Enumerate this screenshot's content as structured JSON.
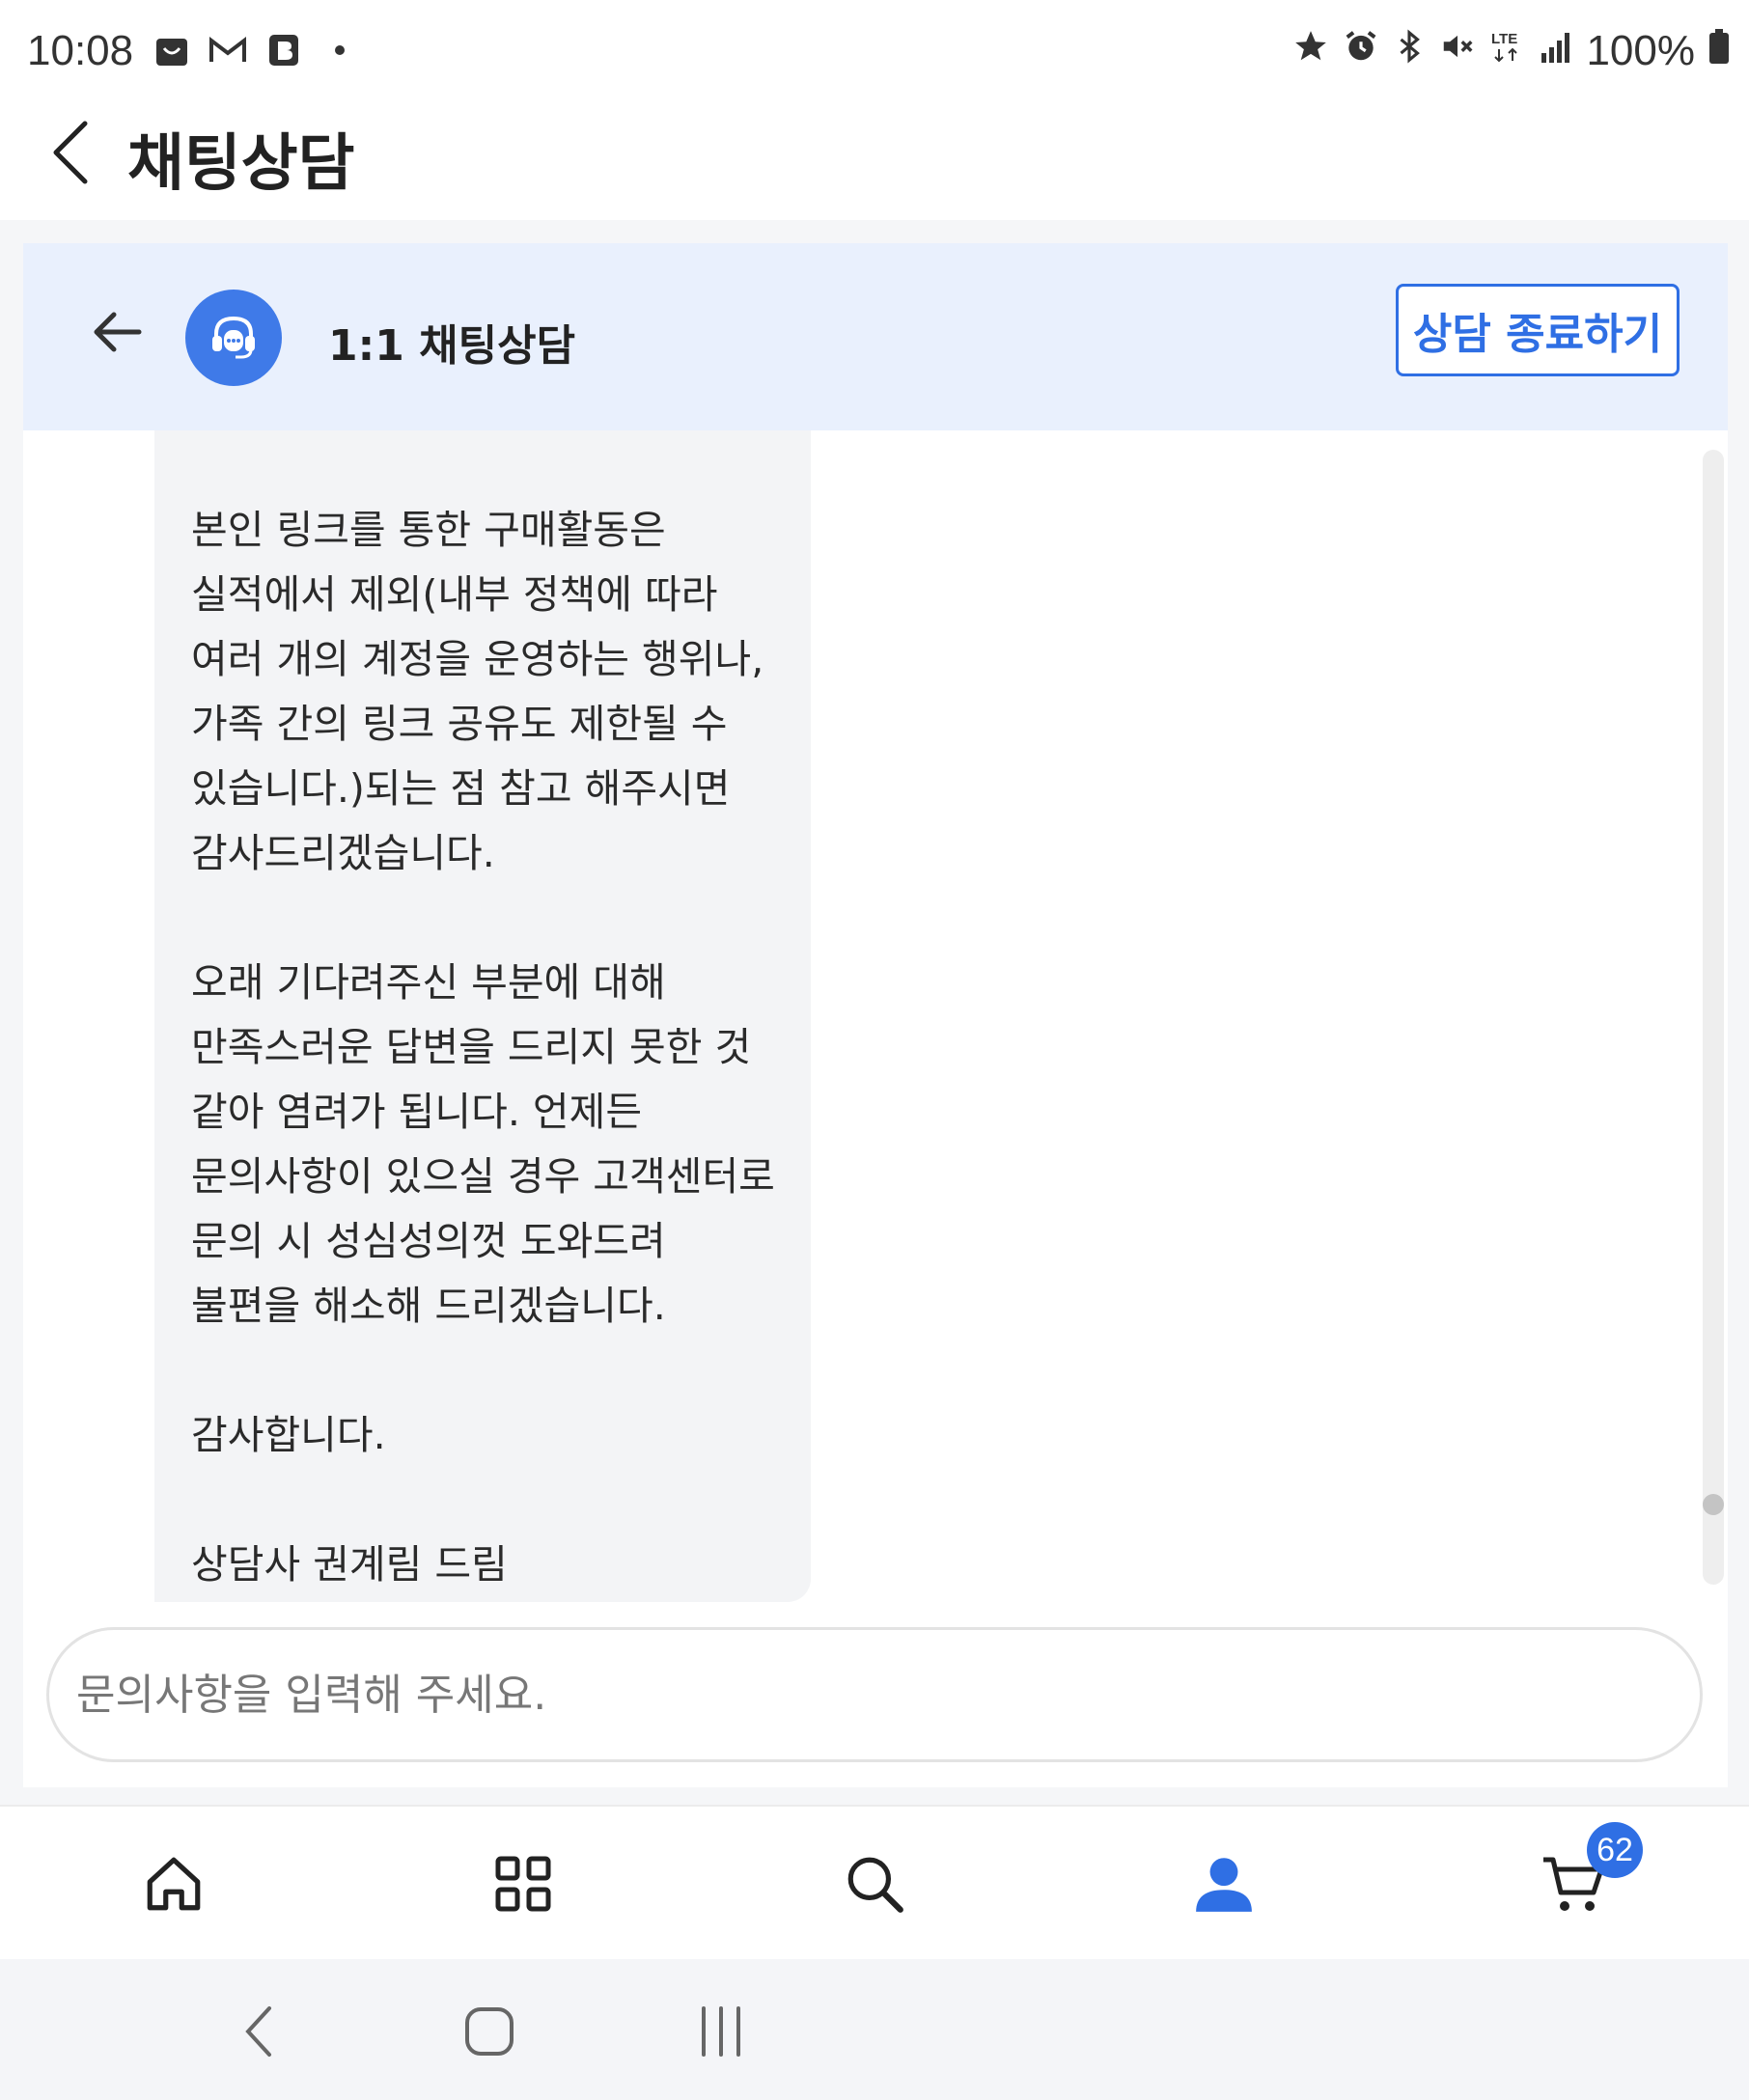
{
  "status_bar": {
    "time": "10:08",
    "battery": "100%",
    "left_icons": [
      "shopping-bag-icon",
      "gmail-icon",
      "b-app-icon",
      "dot-icon"
    ],
    "right_icons": [
      "star-icon",
      "alarm-icon",
      "bluetooth-icon",
      "mute-icon",
      "lte-icon",
      "signal-icon",
      "battery-icon"
    ]
  },
  "app_header": {
    "title": "채팅상담"
  },
  "chat_header": {
    "title": "1:1 채팅상담",
    "end_button_label": "상담 종료하기"
  },
  "message": {
    "paragraphs": [
      "본인 링크를 통한 구매활동은 실적에서 제외(내부 정책에 따라 여러 개의 계정을 운영하는 행위나, 가족 간의 링크 공유도 제한될 수 있습니다.)되는 점 참고 해주시면 감사드리겠습니다.",
      "오래 기다려주신 부분에 대해 만족스러운 답변을 드리지 못한 것 같아 염려가 됩니다. 언제든 문의사항이 있으실 경우 고객센터로 문의 시 성심성의껏 도와드려 불편을 해소해 드리겠습니다.",
      "감사합니다.",
      "상담사 권계림 드림"
    ]
  },
  "input": {
    "placeholder": "문의사항을 입력해 주세요."
  },
  "bottom_nav": {
    "items": [
      "home-icon",
      "categories-icon",
      "search-icon",
      "my-page-icon",
      "cart-icon"
    ],
    "cart_badge": "62",
    "active_color": "#2f6fe4"
  },
  "colors": {
    "accent": "#2f6fe4",
    "chat_header_bg": "#e9f0fd",
    "bubble_bg": "#f3f4f6"
  }
}
